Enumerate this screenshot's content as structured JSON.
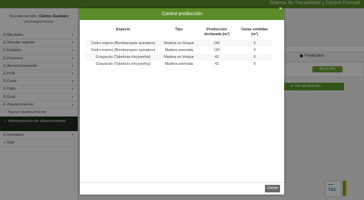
{
  "topbar": {
    "system_title": "Sistema de Trazabilidad y Control Forestal"
  },
  "sidebar": {
    "welcome_prefix": "Sea bienvenido,",
    "user_name": "Carlos Gustaes",
    "user_role": "plumaspermisos",
    "items": [
      {
        "label": "Mis datos",
        "icon": "list-icon",
        "chevron": "▾"
      },
      {
        "label": "Vincular regente",
        "icon": "list-icon",
        "chevron": "▾"
      },
      {
        "label": "Equipos",
        "icon": "list-icon",
        "chevron": "▾"
      },
      {
        "label": "Procesos",
        "icon": "list-icon",
        "chevron": "▾"
      },
      {
        "label": "Aprovechamiento",
        "icon": "list-icon",
        "chevron": "▾"
      },
      {
        "label": "POA",
        "icon": "list-icon",
        "chevron": "▾"
      },
      {
        "label": "Corta",
        "icon": "list-icon",
        "chevron": "▾"
      },
      {
        "label": "Patio",
        "icon": "list-icon",
        "chevron": "▾"
      },
      {
        "label": "Guía",
        "icon": "list-icon",
        "chevron": "▾"
      },
      {
        "label": "Abastecimiento",
        "icon": "list-icon",
        "chevron": "▾"
      },
      {
        "label": "Nuevo abastecimiento",
        "icon": "circle-icon",
        "chevron": ""
      },
      {
        "label": "Administración de abastecimiento",
        "icon": "circle-icon",
        "chevron": ""
      },
      {
        "label": "Inventario",
        "icon": "list-icon",
        "chevron": "▾"
      },
      {
        "label": "Salir",
        "icon": "logout-icon",
        "chevron": ""
      }
    ]
  },
  "background": {
    "legend_label": "Finalizados",
    "status_badge": "Aprobado",
    "approve_button": "Ver aprobación"
  },
  "modal": {
    "title": "Control producción",
    "close_label": "×",
    "columns": [
      "Especie",
      "Tipo",
      "Producción declarada (m³)",
      "Guías emitidas (m³)"
    ],
    "rows": [
      [
        "Cedro espino (Bombacopsis quinatum)",
        "Madera en bloque",
        "140",
        "0"
      ],
      [
        "Cedro espino (Bombacopsis quinatum)",
        "Madera aserrada",
        "130",
        "0"
      ],
      [
        "Guayacán (Tabebuia chrysantha)",
        "Madera en bloque",
        "42",
        "0"
      ],
      [
        "Guayacán (Tabebuia chrysantha)",
        "Madera aserrada",
        "42",
        "0"
      ]
    ],
    "close_button": "Cerrar"
  },
  "logo": {
    "caption": "TAC"
  },
  "colors": {
    "brand_green": "#5b8c28",
    "active_menu": "#1e2d1c",
    "approve_green": "#6da534"
  }
}
